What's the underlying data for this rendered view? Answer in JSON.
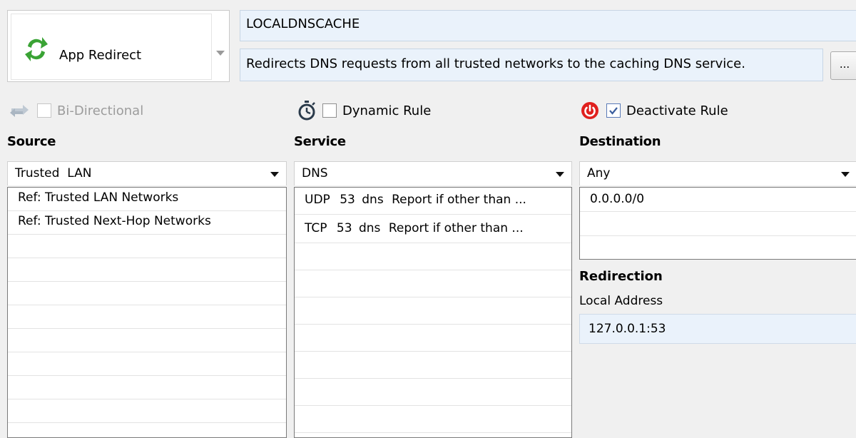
{
  "rule_type": {
    "label": "App Redirect",
    "icon": "app-redirect-icon"
  },
  "rule": {
    "name": "LOCALDNSCACHE",
    "description": "Redirects DNS requests from all trusted networks to the caching DNS service.",
    "more_label": "..."
  },
  "options": {
    "bidirectional": {
      "label": "Bi-Directional",
      "checked": false,
      "enabled": false
    },
    "dynamic": {
      "label": "Dynamic Rule",
      "checked": false,
      "enabled": true
    },
    "deactivate": {
      "label": "Deactivate Rule",
      "checked": true,
      "enabled": true
    }
  },
  "source": {
    "heading": "Source",
    "selected": "Trusted  LAN",
    "items": [
      "Ref: Trusted LAN Networks",
      "Ref: Trusted Next-Hop Networks"
    ]
  },
  "service": {
    "heading": "Service",
    "selected": "DNS",
    "items": [
      {
        "proto": "UDP",
        "port": "53",
        "name": "dns",
        "note": "Report if other than ..."
      },
      {
        "proto": "TCP",
        "port": "53",
        "name": "dns",
        "note": "Report if other than ..."
      }
    ]
  },
  "destination": {
    "heading": "Destination",
    "selected": "Any",
    "items": [
      "0.0.0.0/0"
    ]
  },
  "redirection": {
    "heading": "Redirection",
    "local_address_label": "Local Address",
    "local_address": "127.0.0.1:53"
  },
  "colors": {
    "accent_green": "#3aa335",
    "power_red": "#e0201e",
    "field_bg": "#eaf2fb"
  }
}
